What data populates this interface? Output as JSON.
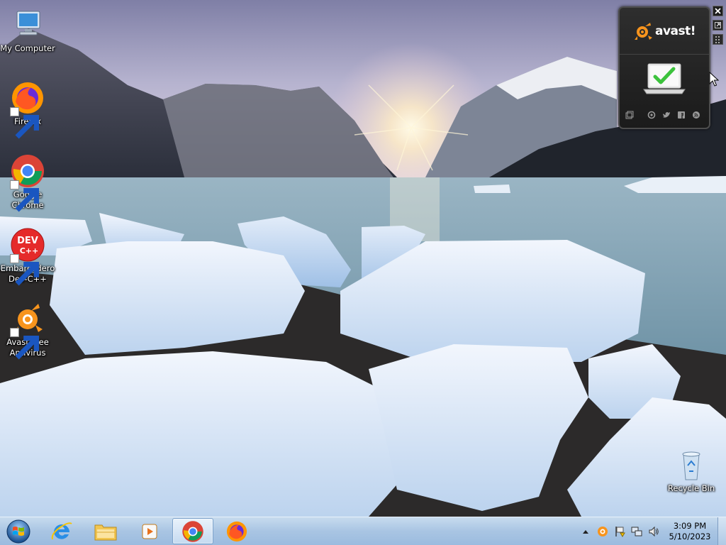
{
  "desktop": {
    "icons": [
      {
        "id": "my-computer",
        "label": "My Computer",
        "shortcut": false
      },
      {
        "id": "firefox",
        "label": "Firefox",
        "shortcut": true
      },
      {
        "id": "google-chrome",
        "label": "Google Chrome",
        "shortcut": true
      },
      {
        "id": "embarcadero-dev-cpp",
        "label": "Embarcadero Dev-C++",
        "shortcut": true
      },
      {
        "id": "avast-free-antivirus",
        "label": "Avast Free Antivirus",
        "shortcut": true
      },
      {
        "id": "recycle-bin",
        "label": "Recycle Bin",
        "shortcut": false
      }
    ],
    "dev_icon_text": {
      "top": "DEV",
      "bottom": "C++"
    }
  },
  "avast_gadget": {
    "logo_text": "avast!",
    "status": "protected",
    "status_icon": "laptop-check-icon",
    "bottom_icons": [
      "window-icon",
      "refresh-icon",
      "twitter-icon",
      "facebook-icon",
      "rss-icon"
    ],
    "brand_color": "#f7941d",
    "check_color": "#3cc23c"
  },
  "taskbar": {
    "pinned": [
      {
        "name": "internet-explorer",
        "active": false
      },
      {
        "name": "file-explorer",
        "active": false
      },
      {
        "name": "media-player",
        "active": false
      },
      {
        "name": "google-chrome",
        "active": true
      },
      {
        "name": "firefox",
        "active": false
      }
    ],
    "tray_icons": [
      "show-hidden-icons-arrow",
      "avast-tray-icon",
      "action-center-flag-icon",
      "network-icon",
      "volume-icon"
    ],
    "clock": {
      "time": "3:09 PM",
      "date": "5/10/2023"
    }
  }
}
